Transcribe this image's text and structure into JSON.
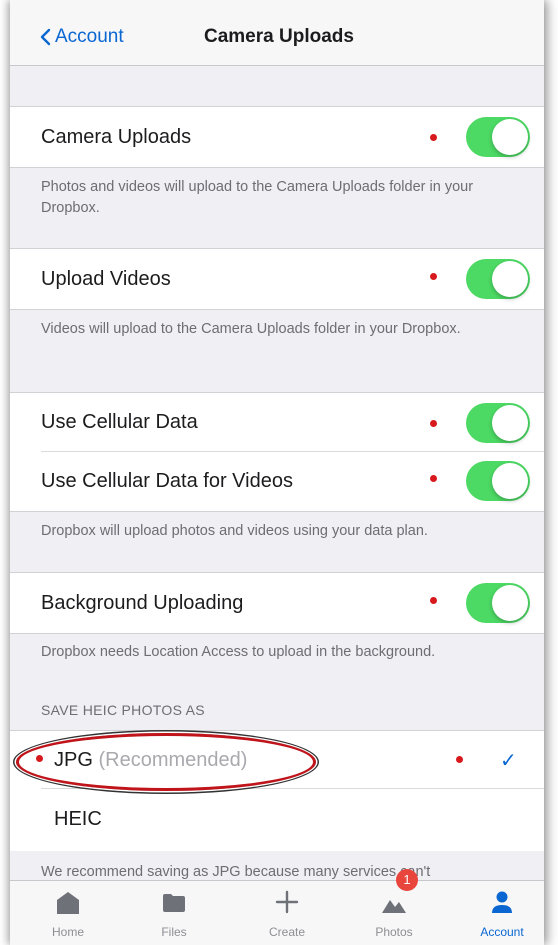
{
  "nav": {
    "back_label": "Account",
    "title": "Camera Uploads"
  },
  "settings": [
    {
      "label": "Camera Uploads",
      "enabled": true
    },
    {
      "label": "Upload Videos",
      "enabled": true
    },
    {
      "label": "Use Cellular Data",
      "enabled": true
    },
    {
      "label": "Use Cellular Data for Videos",
      "enabled": true
    },
    {
      "label": "Background Uploading",
      "enabled": true
    }
  ],
  "footnotes": {
    "camera_uploads": "Photos and videos will upload to the Camera Uploads folder in your Dropbox.",
    "upload_videos": "Videos will upload to the Camera Uploads folder in your Dropbox.",
    "cellular": "Dropbox will upload photos and videos using your data plan.",
    "background": "Dropbox needs Location Access to upload in the background.",
    "heic": "We recommend saving as JPG because many services can't"
  },
  "heic_section": {
    "header": "SAVE HEIC PHOTOS AS",
    "options": [
      {
        "label": "JPG",
        "note": "(Recommended)",
        "selected": true
      },
      {
        "label": "HEIC",
        "note": "",
        "selected": false
      }
    ],
    "check_glyph": "✓"
  },
  "tabs": [
    {
      "label": "Home",
      "icon": "home-icon",
      "active": false
    },
    {
      "label": "Files",
      "icon": "folder-icon",
      "active": false
    },
    {
      "label": "Create",
      "icon": "plus-icon",
      "active": false
    },
    {
      "label": "Photos",
      "icon": "photos-icon",
      "active": false,
      "badge": "1"
    },
    {
      "label": "Account",
      "icon": "person-icon",
      "active": true
    }
  ],
  "colors": {
    "accent": "#0a67d1",
    "toggle_on": "#4cd964",
    "annotation_red": "#d7191d",
    "badge": "#e8453c"
  }
}
